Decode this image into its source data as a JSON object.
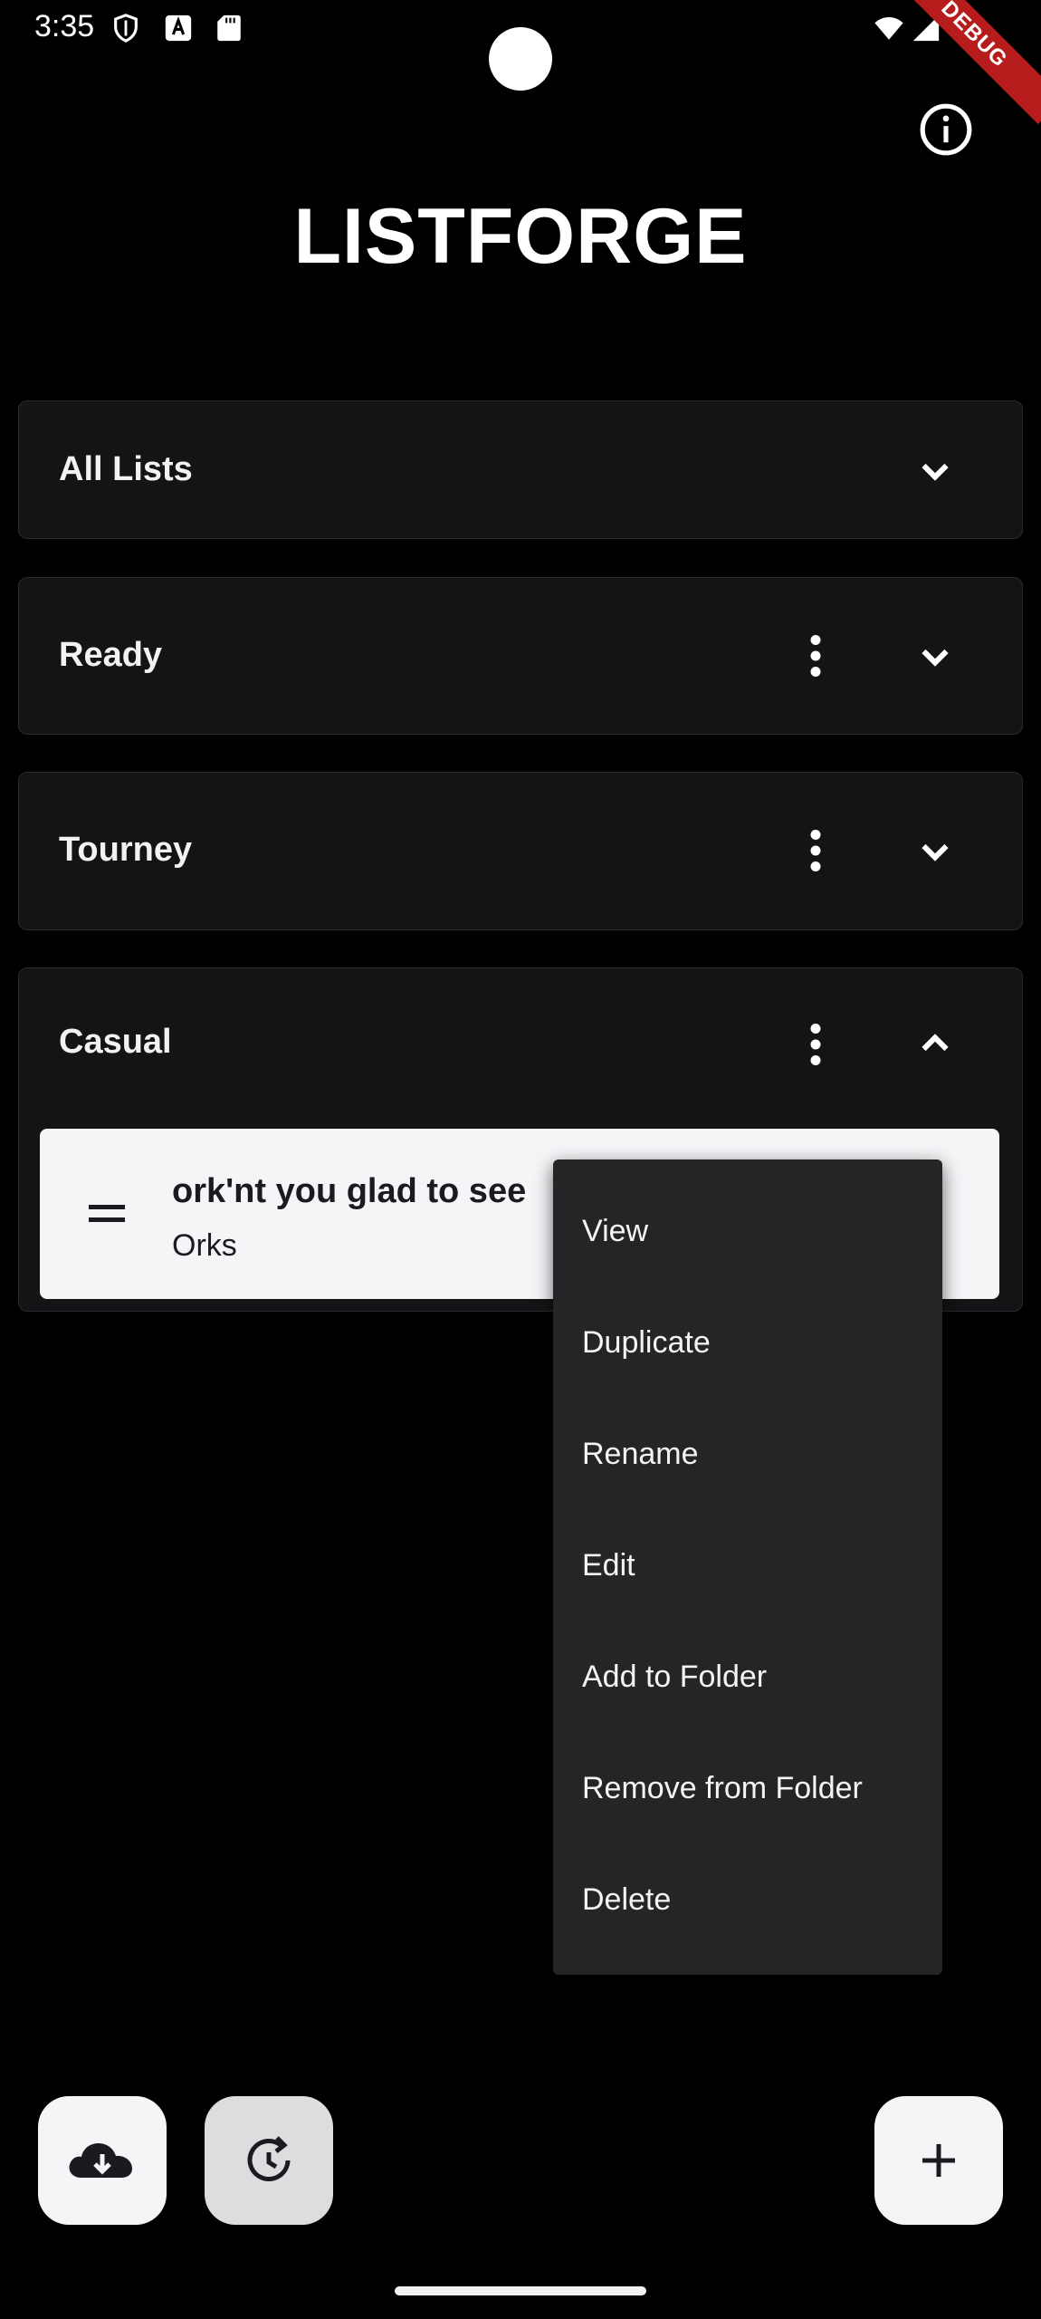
{
  "status_bar": {
    "time": "3:35",
    "icons": [
      "shield-icon",
      "text-a-icon",
      "sd-card-icon",
      "wifi-icon",
      "signal-icon",
      "battery-icon"
    ]
  },
  "debug_banner": "DEBUG",
  "app": {
    "title": "LISTFORGE"
  },
  "folders": [
    {
      "label": "All Lists",
      "expanded": false,
      "has_menu": false
    },
    {
      "label": "Ready",
      "expanded": false,
      "has_menu": true
    },
    {
      "label": "Tourney",
      "expanded": false,
      "has_menu": true
    },
    {
      "label": "Casual",
      "expanded": true,
      "has_menu": true
    }
  ],
  "list_item": {
    "title": "ork'nt you glad to see",
    "subtitle": "Orks"
  },
  "context_menu": {
    "items": [
      "View",
      "Duplicate",
      "Rename",
      "Edit",
      "Add to Folder",
      "Remove from Folder",
      "Delete"
    ]
  },
  "fabs": {
    "import_icon": "cloud-download-icon",
    "restore_icon": "restore-icon",
    "add_icon": "add-icon"
  },
  "colors": {
    "background": "#000000",
    "folder_bg": "#141416",
    "card_bg": "#f5f4f7",
    "menu_bg": "#252528",
    "debug_banner": "#b71c1c"
  }
}
